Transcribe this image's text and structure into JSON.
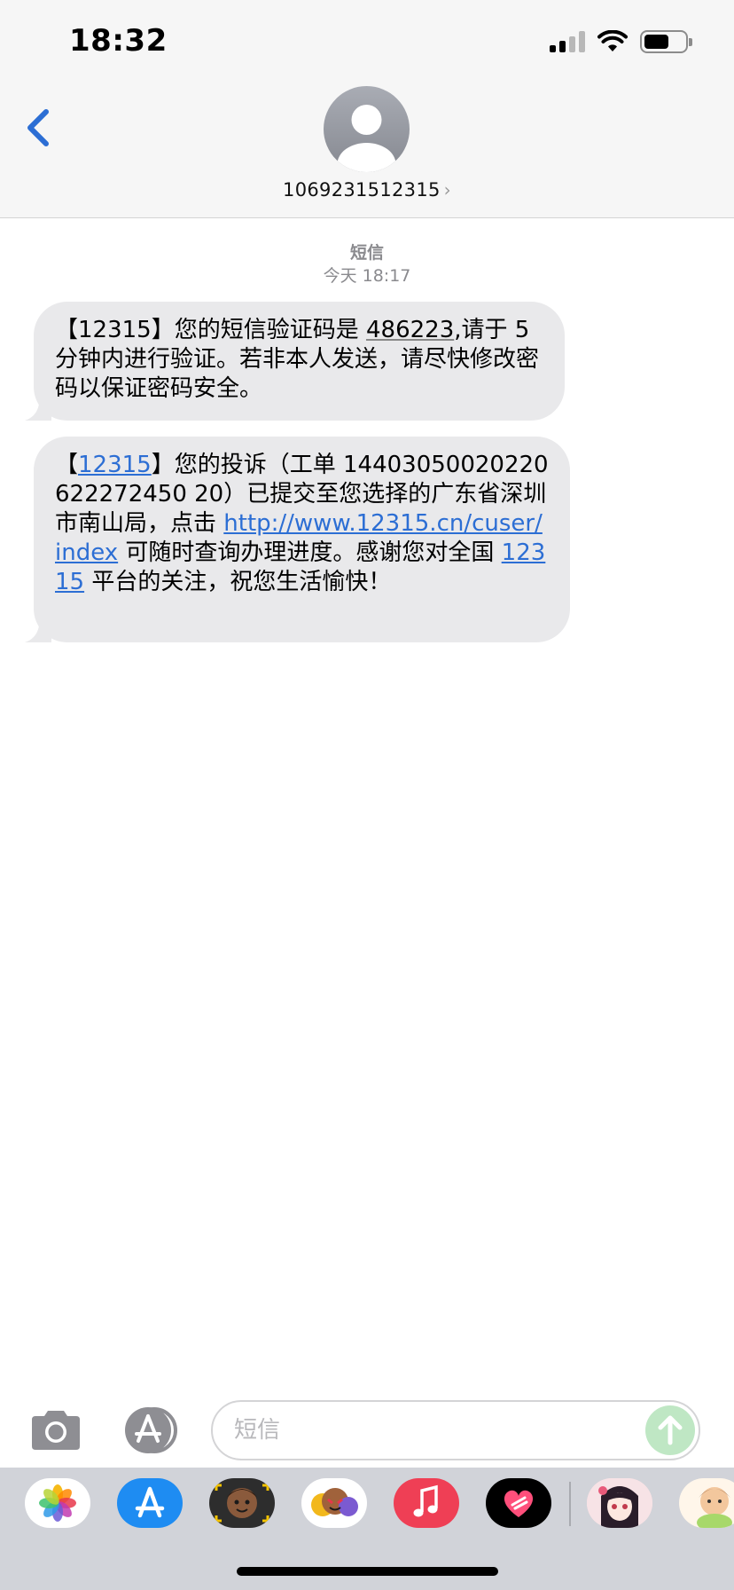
{
  "status_bar": {
    "time": "18:32",
    "signal_bars_filled": 2,
    "signal_bars_total": 4,
    "battery_level": 0.62
  },
  "header": {
    "back_icon": "chevron-left-icon",
    "avatar_icon": "person-avatar-icon",
    "contact_name": "1069231512315",
    "contact_chevron": "›"
  },
  "conversation": {
    "service_label": "短信",
    "date_label": "今天 18:17",
    "messages": [
      {
        "segments": [
          {
            "text": "【12315】您的短信验证码是 ",
            "type": "text"
          },
          {
            "text": "486223",
            "type": "code"
          },
          {
            "text": ",请于 5 分钟内进行验证。若非本人发送，请尽快修改密码以保证密码安全。",
            "type": "text"
          }
        ]
      },
      {
        "segments": [
          {
            "text": "【",
            "type": "text"
          },
          {
            "text": "12315",
            "type": "link"
          },
          {
            "text": "】您的投诉（工单 14403050020220622272450 20）已提交至您选择的广东省深圳市南山局，点击 ",
            "type": "text"
          },
          {
            "text": "http://www.12315.cn/cuser/index",
            "type": "link"
          },
          {
            "text": " 可随时查询办理进度。感谢您对全国 ",
            "type": "text"
          },
          {
            "text": "12315",
            "type": "link"
          },
          {
            "text": " 平台的关注，祝您生活愉快！",
            "type": "text"
          }
        ]
      }
    ]
  },
  "input_bar": {
    "camera_icon": "camera-icon",
    "appstore_icon": "app-store-icon",
    "placeholder": "短信",
    "send_icon": "arrow-up-icon"
  },
  "app_drawer": {
    "apps": [
      "photos-app-icon",
      "app-store-app-icon",
      "memoji-app-icon",
      "animoji-app-icon",
      "music-app-icon",
      "digital-touch-app-icon",
      "anime-sticker-app-icon",
      "cartoon-sticker-app-icon"
    ]
  },
  "colors": {
    "accent": "#2c6ed4",
    "bubble": "#e9e9eb",
    "header_bg": "#f6f6f6",
    "drawer_bg": "#d1d3d9"
  }
}
